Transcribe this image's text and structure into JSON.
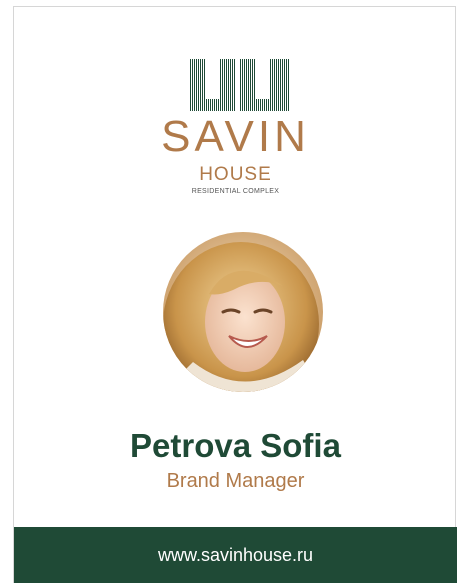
{
  "colors": {
    "accent_copper": "#b07a4a",
    "brand_green": "#1f4a36",
    "text_gray": "#555555"
  },
  "logo": {
    "icon": "striped-building-logo-icon",
    "title": "SAVIN",
    "subtitle": "HOUSE",
    "tagline": "RESIDENTIAL COMPLEX"
  },
  "person": {
    "photo_icon": "smiling-woman-portrait",
    "name": "Petrova Sofia",
    "role": "Brand Manager"
  },
  "footer": {
    "website": "www.savinhouse.ru"
  }
}
